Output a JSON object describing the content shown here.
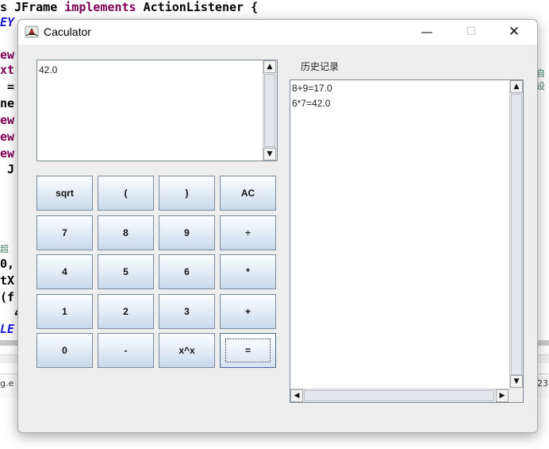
{
  "ide": {
    "lines": [
      {
        "pre": "s JFrame ",
        "kw": "implements",
        "post": " ActionListener {"
      },
      {
        "text": "EY"
      },
      {
        "text": "ew"
      },
      {
        "text": "xt"
      },
      {
        "text": " ="
      },
      {
        "text": "ne"
      },
      {
        "text": "ew"
      },
      {
        "text": "ew"
      },
      {
        "text": "ew"
      },
      {
        "text": " J"
      },
      {
        "text": "0,"
      },
      {
        "text": "tX"
      },
      {
        "text": "(f"
      },
      {
        "text": "  4"
      },
      {
        "text": "LE"
      }
    ],
    "note_right": "自设",
    "note_left": "超",
    "status_left": "g.e",
    "status_right": "23"
  },
  "window": {
    "title": "Caculator",
    "minimize_glyph": "—",
    "maximize_glyph": "☐",
    "close_glyph": "✕"
  },
  "display": {
    "value": "42.0"
  },
  "keypad": {
    "rows": [
      [
        "sqrt",
        "(",
        ")",
        "AC"
      ],
      [
        "7",
        "8",
        "9",
        "÷"
      ],
      [
        "4",
        "5",
        "6",
        "*"
      ],
      [
        "1",
        "2",
        "3",
        "+"
      ],
      [
        "0",
        "-",
        "x^x",
        "="
      ]
    ]
  },
  "history": {
    "label": "历史记录",
    "entries": [
      "8+9=17.0",
      "6*7=42.0"
    ]
  },
  "icons": {
    "app": "java-duke-icon",
    "scroll_up": "▲",
    "scroll_down": "▼",
    "scroll_left": "◀",
    "scroll_right": "▶"
  }
}
